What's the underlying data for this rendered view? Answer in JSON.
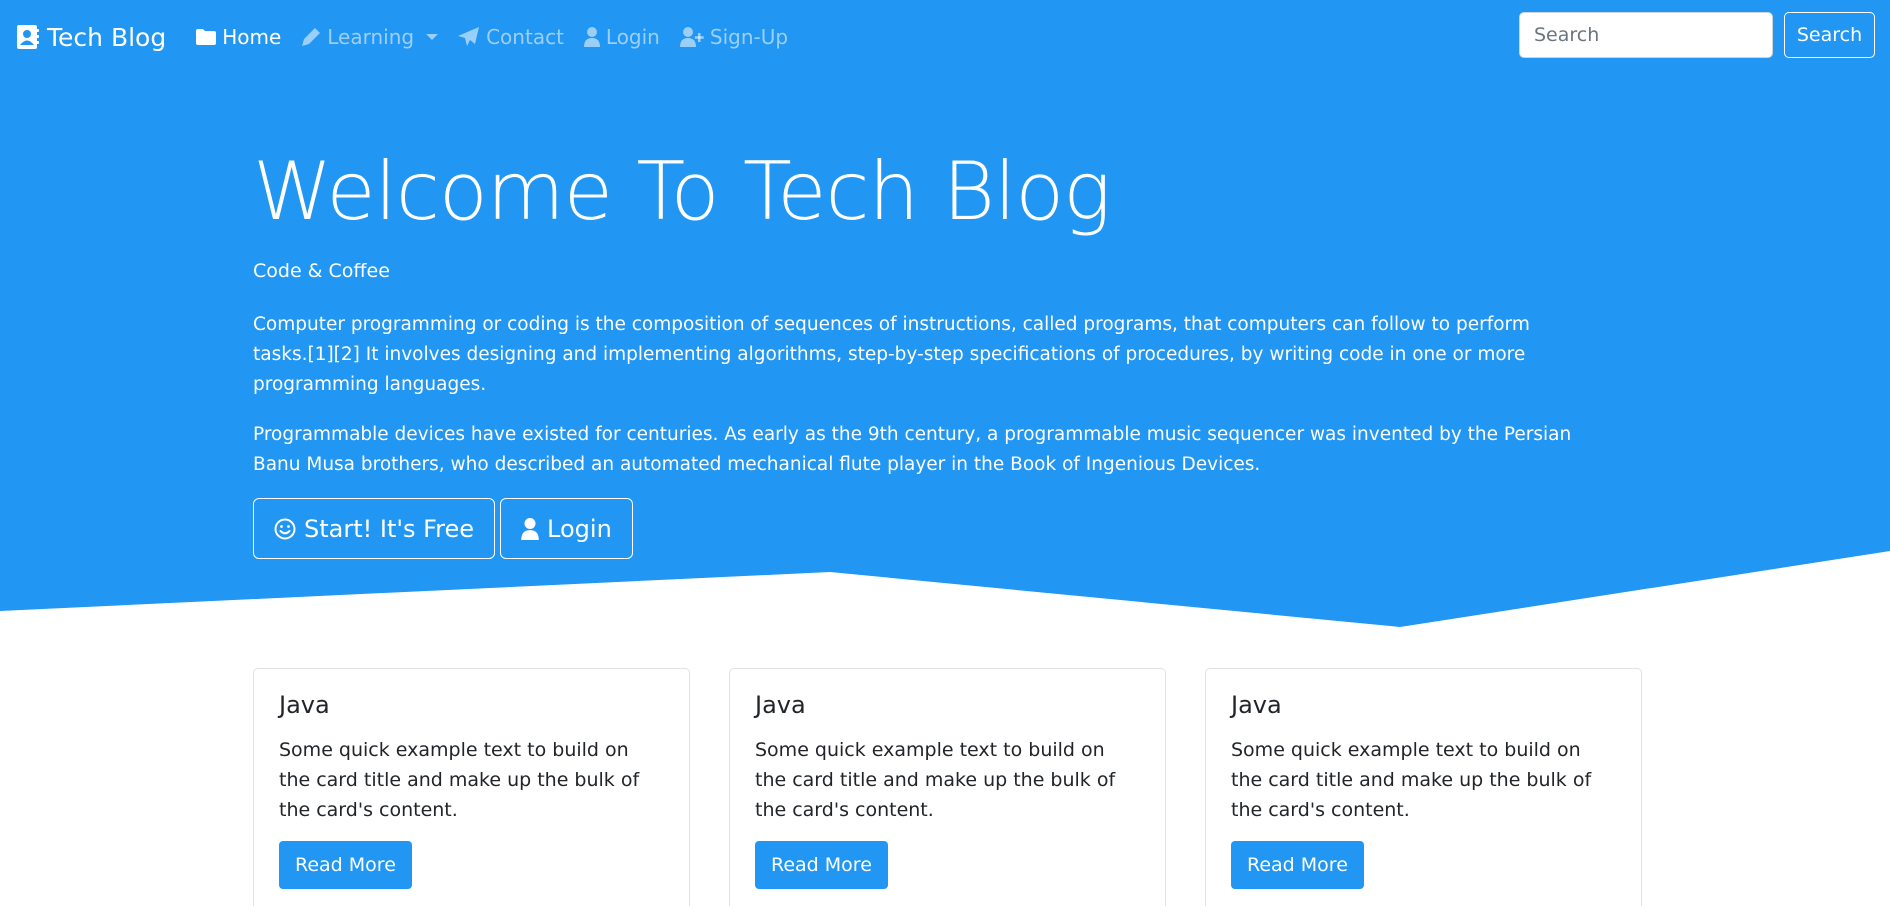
{
  "colors": {
    "primary": "#2196f3",
    "white": "#ffffff"
  },
  "navbar": {
    "brand": "Tech Blog",
    "brand_icon": "user-card-icon",
    "items": [
      {
        "label": "Home",
        "icon": "folder-icon",
        "active": true
      },
      {
        "label": "Learning",
        "icon": "pen-icon",
        "dropdown": true
      },
      {
        "label": "Contact",
        "icon": "paper-plane-icon"
      },
      {
        "label": "Login",
        "icon": "user-icon"
      },
      {
        "label": "Sign-Up",
        "icon": "user-plus-icon"
      }
    ],
    "search": {
      "placeholder": "Search",
      "button_label": "Search"
    }
  },
  "hero": {
    "title": "Welcome To Tech Blog",
    "tagline": "Code & Coffee",
    "paragraphs": [
      "Computer programming or coding is the composition of sequences of instructions, called programs, that computers can follow to perform tasks.[1][2] It involves designing and implementing algorithms, step-by-step specifications of procedures, by writing code in one or more programming languages.",
      "Programmable devices have existed for centuries. As early as the 9th century, a programmable music sequencer was invented by the Persian Banu Musa brothers, who described an automated mechanical flute player in the Book of Ingenious Devices."
    ],
    "buttons": [
      {
        "label": "Start! It's Free",
        "icon": "smile-icon"
      },
      {
        "label": "Login",
        "icon": "user-icon"
      }
    ]
  },
  "cards": [
    {
      "title": "Java",
      "text": "Some quick example text to build on the card title and make up the bulk of the card's content.",
      "button_label": "Read More"
    },
    {
      "title": "Java",
      "text": "Some quick example text to build on the card title and make up the bulk of the card's content.",
      "button_label": "Read More"
    },
    {
      "title": "Java",
      "text": "Some quick example text to build on the card title and make up the bulk of the card's content.",
      "button_label": "Read More"
    }
  ]
}
